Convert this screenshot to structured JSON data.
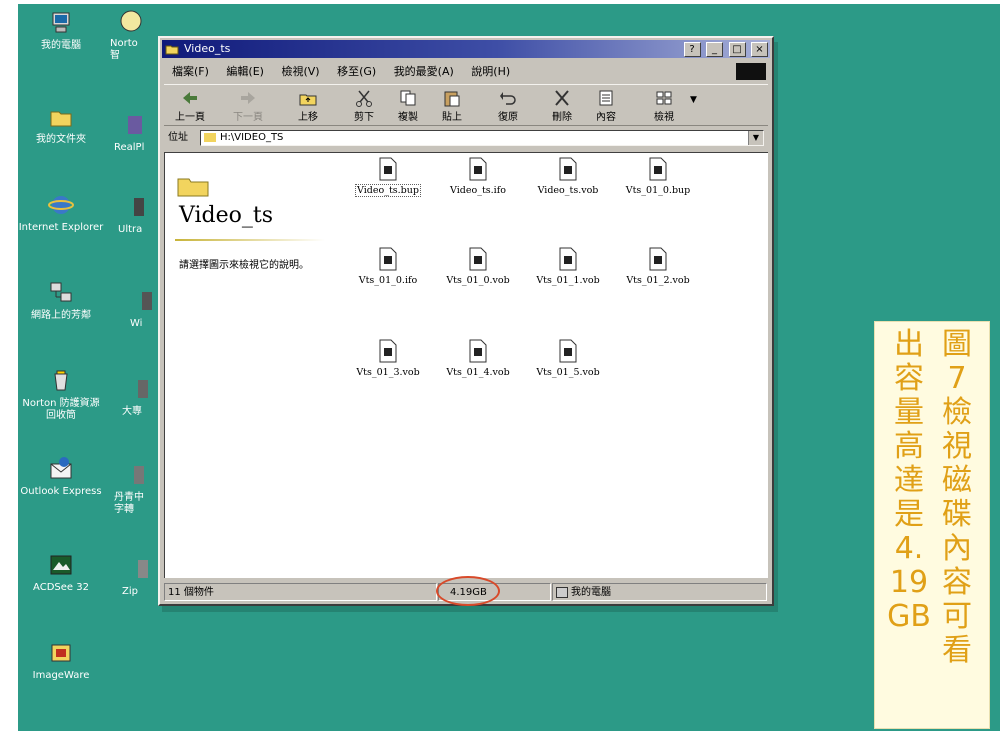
{
  "desktop": {
    "icons_left": [
      {
        "label": "我的電腦",
        "icon": "computer-icon"
      },
      {
        "label": "我的文件夾",
        "icon": "folder-icon"
      },
      {
        "label": "Internet Explorer",
        "icon": "ie-icon"
      },
      {
        "label": "網路上的芳鄰",
        "icon": "network-icon"
      },
      {
        "label": "Norton 防護資源回收筒",
        "icon": "recycle-icon"
      },
      {
        "label": "Outlook Express",
        "icon": "outlook-icon"
      },
      {
        "label": "ACDSee 32",
        "icon": "acdsee-icon"
      },
      {
        "label": "ImageWare",
        "icon": "imageware-icon"
      }
    ],
    "icons_partial": [
      {
        "label": "Norto 智",
        "icon": "app-icon"
      },
      {
        "label": "RealPl",
        "icon": "app-icon"
      },
      {
        "label": "Ultra",
        "icon": "app-icon"
      },
      {
        "label": "Wi",
        "icon": "app-icon"
      },
      {
        "label": "大專",
        "icon": "app-icon"
      },
      {
        "label": "丹青中 字轉",
        "icon": "app-icon"
      },
      {
        "label": "Zip",
        "icon": "app-icon"
      }
    ]
  },
  "window": {
    "title": "Video_ts",
    "title_buttons": [
      "?",
      "_",
      "□",
      "×"
    ],
    "menu": [
      "檔案(F)",
      "編輯(E)",
      "檢視(V)",
      "移至(G)",
      "我的最愛(A)",
      "說明(H)"
    ],
    "toolbar": [
      {
        "label": "上一頁",
        "icon": "back-arrow-icon",
        "disabled": false
      },
      {
        "label": "下一頁",
        "icon": "forward-arrow-icon",
        "disabled": true
      },
      {
        "label": "上移",
        "icon": "up-folder-icon",
        "disabled": false
      },
      {
        "label": "剪下",
        "icon": "cut-icon",
        "disabled": false
      },
      {
        "label": "複製",
        "icon": "copy-icon",
        "disabled": false
      },
      {
        "label": "貼上",
        "icon": "paste-icon",
        "disabled": false
      },
      {
        "label": "復原",
        "icon": "undo-icon",
        "disabled": false
      },
      {
        "label": "刪除",
        "icon": "delete-icon",
        "disabled": false
      },
      {
        "label": "內容",
        "icon": "properties-icon",
        "disabled": false
      },
      {
        "label": "檢視",
        "icon": "views-icon",
        "disabled": false
      }
    ],
    "address_label": "位址",
    "address_value": "H:\\VIDEO_TS",
    "left_pane": {
      "title": "Video_ts",
      "description": "請選擇圖示來檢視它的說明。"
    },
    "files": [
      "Video_ts.bup",
      "Video_ts.ifo",
      "Video_ts.vob",
      "Vts_01_0.bup",
      "Vts_01_0.ifo",
      "Vts_01_0.vob",
      "Vts_01_1.vob",
      "Vts_01_2.vob",
      "Vts_01_3.vob",
      "Vts_01_4.vob",
      "Vts_01_5.vob"
    ],
    "status": {
      "count": "11 個物件",
      "size": "4.19GB",
      "location": "我的電腦"
    }
  },
  "caption": {
    "col1": "圖7 檢視磁碟內容可看",
    "col2": "出容量高達是4.19GB"
  },
  "colors": {
    "desktop": "#2c9a87",
    "title_gradient_start": "#101a7a",
    "caption_text": "#e0a017",
    "highlight_circle": "#d84a2a"
  }
}
